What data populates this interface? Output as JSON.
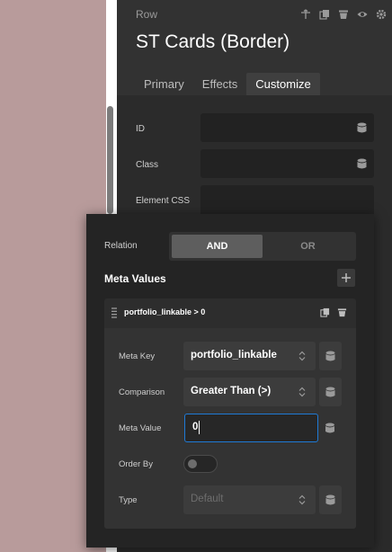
{
  "panel": {
    "element_type": "Row",
    "title": "ST Cards (Border)",
    "tabs": [
      {
        "label": "Primary",
        "active": false
      },
      {
        "label": "Effects",
        "active": false
      },
      {
        "label": "Customize",
        "active": true
      }
    ],
    "header_icons": [
      "move-icon",
      "copy-icon",
      "trash-icon",
      "eye-icon",
      "settings-icon"
    ],
    "fields": [
      {
        "label": "ID",
        "value": ""
      },
      {
        "label": "Class",
        "value": ""
      },
      {
        "label": "Element CSS",
        "value": ""
      }
    ]
  },
  "popover": {
    "relation_label": "Relation",
    "relation_options": [
      "AND",
      "OR"
    ],
    "relation_selected": "AND",
    "meta_values_title": "Meta Values",
    "rule": {
      "title": "portfolio_linkable > 0",
      "meta_key_label": "Meta Key",
      "meta_key_value": "portfolio_linkable",
      "comparison_label": "Comparison",
      "comparison_value": "Greater Than (>)",
      "meta_value_label": "Meta Value",
      "meta_value_value": "0",
      "order_by_label": "Order By",
      "order_by_on": false,
      "type_label": "Type",
      "type_placeholder": "Default"
    }
  },
  "colors": {
    "panel_bg": "#2b2b2b",
    "popover_bg": "#242424",
    "accent_focus": "#1f7ad6",
    "canvas_bg": "#b89b9b"
  }
}
